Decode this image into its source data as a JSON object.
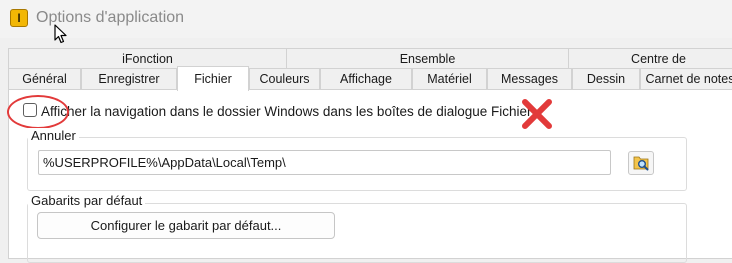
{
  "window": {
    "title": "Options d'application",
    "app_icon_letter": "I"
  },
  "tab_groups": [
    {
      "label": "iFonction"
    },
    {
      "label": "Ensemble"
    },
    {
      "label": "Centre de"
    }
  ],
  "tabs": [
    {
      "label": "Général"
    },
    {
      "label": "Enregistrer"
    },
    {
      "label": "Fichier",
      "active": true
    },
    {
      "label": "Couleurs"
    },
    {
      "label": "Affichage"
    },
    {
      "label": "Matériel"
    },
    {
      "label": "Messages"
    },
    {
      "label": "Dessin"
    },
    {
      "label": "Carnet de notes"
    }
  ],
  "file_options": {
    "nav_checkbox_label": "Afficher la navigation dans le dossier Windows dans les boîtes de dialogue Fichier",
    "nav_checkbox_checked": false,
    "undo_group_label": "Annuler",
    "undo_path_value": "%USERPROFILE%\\AppData\\Local\\Temp\\",
    "templates_group_label": "Gabarits par défaut",
    "configure_template_button": "Configurer le gabarit par défaut..."
  },
  "colors": {
    "annotation_red": "#e23a3a",
    "app_icon_yellow": "#f2b705"
  },
  "icons": {
    "app": "app-logo-icon",
    "browse": "browse-folder-icon",
    "cross": "red-x-icon",
    "cursor": "mouse-cursor-icon"
  }
}
